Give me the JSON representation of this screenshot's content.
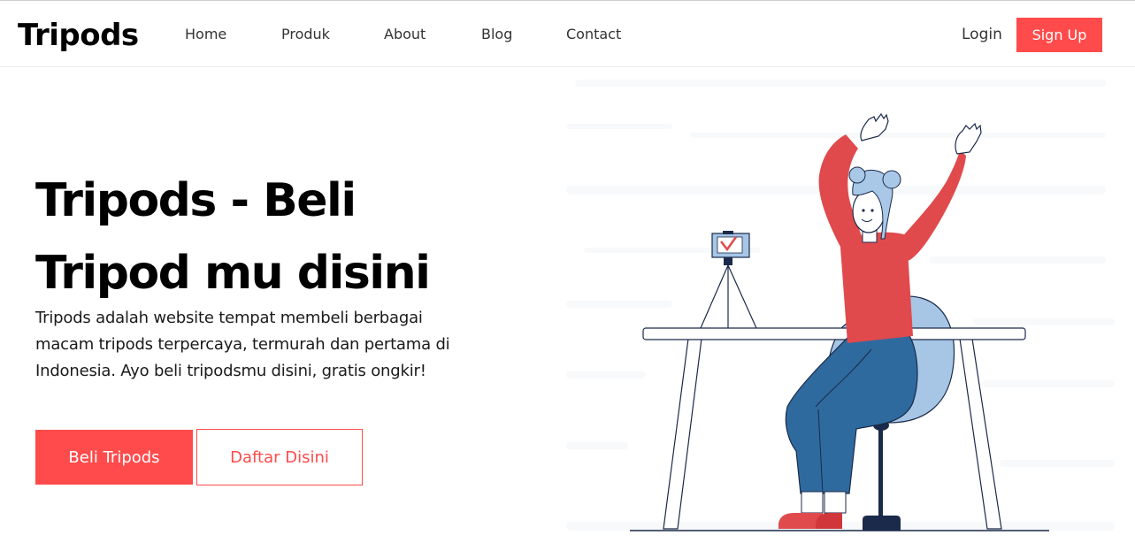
{
  "nav": {
    "brand": "Tripods",
    "links": [
      "Home",
      "Produk",
      "About",
      "Blog",
      "Contact"
    ],
    "login": "Login",
    "signup": "Sign Up"
  },
  "hero": {
    "title_line1": "Tripods - Beli",
    "title_line2": "Tripod mu disini",
    "description": "Tripods adalah website tempat membeli berbagai macam tripods terpercaya, termurah dan pertama di Indonesia. Ayo beli tripodsmu disini, gratis ongkir!",
    "primary_button": "Beli Tripods",
    "secondary_button": "Daftar Disini"
  },
  "colors": {
    "accent": "#ff4b4b",
    "shirt": "#e04a4d",
    "pants": "#2e6a9e",
    "hair": "#a9c8e8",
    "chair": "#a7c6e6",
    "outline": "#1b2a4a"
  },
  "illustration": {
    "icon": "person-waving-at-camera-illustration"
  }
}
